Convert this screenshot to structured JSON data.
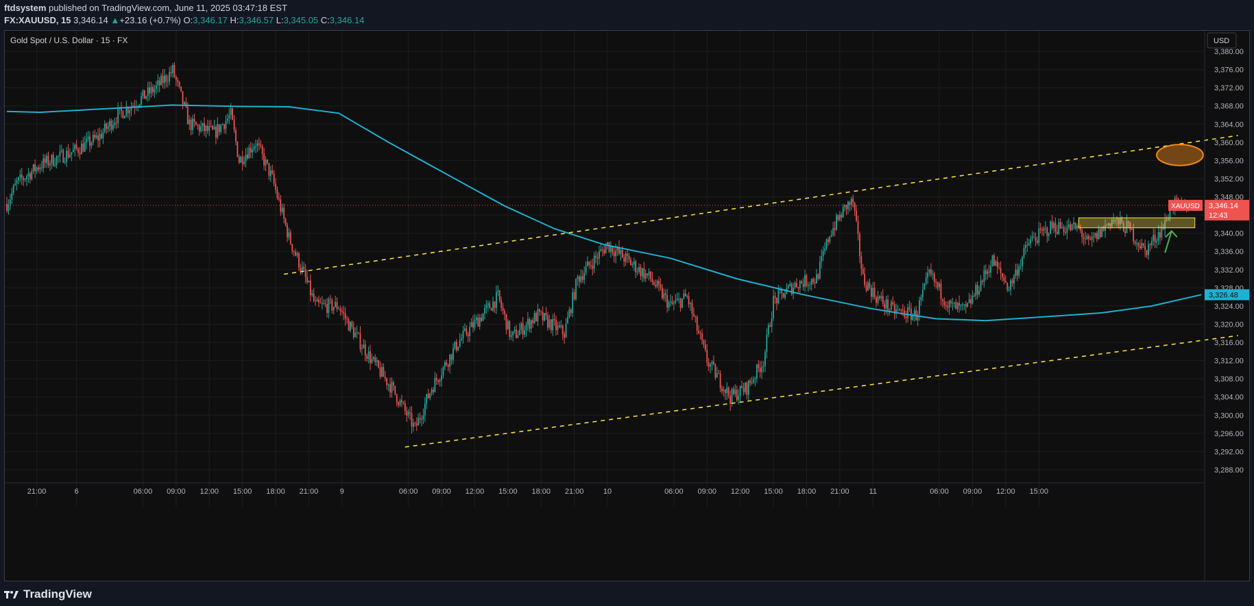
{
  "header": {
    "publisher": "ftdsystem",
    "published_text": " published on TradingView.com, June 11, 2025 03:47:18 EST",
    "symbol_line": {
      "symbol": "FX:XAUUSD, 15",
      "last": "3,346.14",
      "change_arrow": "▲",
      "change": "+23.16 (+0.7%)",
      "o_label": "O:",
      "o": "3,346.17",
      "h_label": "H:",
      "h": "3,346.57",
      "l_label": "L:",
      "l": "3,345.05",
      "c_label": "C:",
      "c": "3,346.14"
    }
  },
  "chart_title": "Gold Spot / U.S. Dollar · 15 · FX",
  "currency_button": "USD",
  "price_badge": {
    "symbol": "XAUUSD",
    "price": "3,346.14",
    "countdown": "12:43"
  },
  "ma_badge": "3,326.48",
  "footer": {
    "logo_text": "TradingView"
  },
  "colors": {
    "background": "#0f0f0f",
    "up": "#26a69a",
    "down": "#ef5350",
    "ma_line": "#1fb1d1",
    "channel": "#f5e04a",
    "highlight_box": "#f5e04a",
    "circle": "#f08a1d",
    "arrow": "#4caf50"
  },
  "icons": {
    "logo": "tradingview-logo-icon",
    "arrow": "up-arrow-annotation-icon"
  },
  "chart_data": {
    "type": "candlestick",
    "title": "Gold Spot / U.S. Dollar · 15 · FX",
    "xlabel": "",
    "ylabel": "",
    "ylim": [
      3285,
      3382
    ],
    "y_ticks": [
      "3,380.00",
      "3,376.00",
      "3,372.00",
      "3,368.00",
      "3,364.00",
      "3,360.00",
      "3,356.00",
      "3,352.00",
      "3,348.00",
      "3,344.00",
      "3,340.00",
      "3,336.00",
      "3,332.00",
      "3,328.00",
      "3,324.00",
      "3,320.00",
      "3,316.00",
      "3,312.00",
      "3,308.00",
      "3,304.00",
      "3,300.00",
      "3,296.00",
      "3,292.00",
      "3,288.00"
    ],
    "y_tick_values": [
      3380,
      3376,
      3372,
      3368,
      3364,
      3360,
      3356,
      3352,
      3348,
      3344,
      3340,
      3336,
      3332,
      3328,
      3324,
      3320,
      3316,
      3312,
      3308,
      3304,
      3300,
      3296,
      3292,
      3288
    ],
    "x_ticks": [
      "21:00",
      "6",
      "06:00",
      "09:00",
      "12:00",
      "15:00",
      "18:00",
      "21:00",
      "9",
      "06:00",
      "09:00",
      "12:00",
      "15:00",
      "18:00",
      "21:00",
      "10",
      "06:00",
      "09:00",
      "12:00",
      "15:00",
      "18:00",
      "21:00",
      "11",
      "06:00",
      "09:00",
      "12:00",
      "15:00"
    ],
    "x_tick_bars": [
      18,
      42,
      82,
      102,
      122,
      142,
      162,
      182,
      202,
      242,
      262,
      282,
      302,
      322,
      342,
      362,
      402,
      422,
      442,
      462,
      482,
      502,
      522,
      562,
      582,
      602,
      622
    ],
    "bar_count": 596,
    "last_price": 3346.14,
    "moving_average": {
      "last": 3326.48,
      "points": [
        [
          0,
          3366.8
        ],
        [
          20,
          3366.6
        ],
        [
          60,
          3367.4
        ],
        [
          100,
          3368.2
        ],
        [
          140,
          3367.9
        ],
        [
          170,
          3367.8
        ],
        [
          200,
          3366.4
        ],
        [
          230,
          3360
        ],
        [
          270,
          3352
        ],
        [
          300,
          3346
        ],
        [
          330,
          3341
        ],
        [
          360,
          3337.5
        ],
        [
          380,
          3336
        ],
        [
          400,
          3334.5
        ],
        [
          440,
          3330
        ],
        [
          480,
          3326.5
        ],
        [
          520,
          3323.5
        ],
        [
          540,
          3322.3
        ],
        [
          560,
          3321.2
        ],
        [
          590,
          3320.8
        ],
        [
          620,
          3321.5
        ],
        [
          660,
          3322.5
        ],
        [
          690,
          3324
        ],
        [
          720,
          3326.5
        ]
      ]
    },
    "trend_lines": [
      {
        "name": "upper-channel",
        "from": [
          167,
          3331
        ],
        "to": [
          742,
          3361.5
        ]
      },
      {
        "name": "lower-channel",
        "from": [
          240,
          3293
        ],
        "to": [
          742,
          3317.5
        ]
      }
    ],
    "zone": {
      "x_from": 646,
      "x_to": 716,
      "y_from": 3341.2,
      "y_to": 3343.4
    },
    "ellipse": {
      "center": [
        707,
        3357.2
      ],
      "rx": 14,
      "ry": 2.3
    },
    "arrow": {
      "from": [
        698,
        3335.7
      ],
      "to": [
        702,
        3340.5
      ]
    },
    "series": [
      {
        "name": "XAUUSD",
        "anchors": [
          [
            0,
            3346.5
          ],
          [
            6,
            3351
          ],
          [
            20,
            3355
          ],
          [
            40,
            3358
          ],
          [
            55,
            3361
          ],
          [
            67,
            3366
          ],
          [
            90,
            3372
          ],
          [
            100,
            3375.8
          ],
          [
            110,
            3364
          ],
          [
            125,
            3362
          ],
          [
            135,
            3366
          ],
          [
            140,
            3356
          ],
          [
            150,
            3360
          ],
          [
            160,
            3352
          ],
          [
            170,
            3339
          ],
          [
            180,
            3330
          ],
          [
            186,
            3324
          ],
          [
            200,
            3324
          ],
          [
            206,
            3320
          ],
          [
            220,
            3312
          ],
          [
            232,
            3306
          ],
          [
            246,
            3297
          ],
          [
            256,
            3306
          ],
          [
            272,
            3316
          ],
          [
            296,
            3326
          ],
          [
            304,
            3317
          ],
          [
            320,
            3322
          ],
          [
            336,
            3318
          ],
          [
            344,
            3330
          ],
          [
            362,
            3337.5
          ],
          [
            388,
            3330
          ],
          [
            400,
            3324
          ],
          [
            410,
            3326
          ],
          [
            422,
            3312
          ],
          [
            436,
            3304
          ],
          [
            446,
            3306
          ],
          [
            456,
            3312
          ],
          [
            462,
            3325
          ],
          [
            476,
            3329
          ],
          [
            488,
            3330
          ],
          [
            496,
            3340
          ],
          [
            506,
            3346
          ],
          [
            510,
            3346.8
          ],
          [
            516,
            3330
          ],
          [
            524,
            3326
          ],
          [
            534,
            3323
          ],
          [
            548,
            3322
          ],
          [
            556,
            3331
          ],
          [
            568,
            3324
          ],
          [
            578,
            3323
          ],
          [
            594,
            3334
          ],
          [
            604,
            3328
          ],
          [
            616,
            3338
          ],
          [
            630,
            3341.5
          ],
          [
            646,
            3341
          ],
          [
            652,
            3337.5
          ],
          [
            666,
            3343
          ],
          [
            676,
            3341
          ],
          [
            686,
            3336
          ],
          [
            698,
            3342
          ],
          [
            702,
            3346.6
          ],
          [
            708,
            3345.6
          ],
          [
            712,
            3346.14
          ]
        ]
      }
    ]
  }
}
